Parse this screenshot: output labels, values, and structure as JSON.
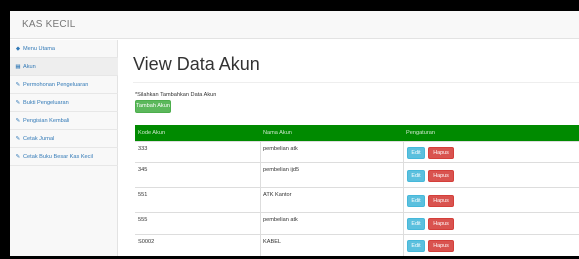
{
  "app": {
    "brand": "KAS KECIL"
  },
  "sidebar": {
    "items": [
      {
        "icon": "dashboard-icon",
        "glyph": "◆",
        "label": "Menu Utama"
      },
      {
        "icon": "table-icon",
        "glyph": "▦",
        "label": "Akun"
      },
      {
        "icon": "edit-icon",
        "glyph": "✎",
        "label": "Permohonan Pengeluaran"
      },
      {
        "icon": "edit-icon",
        "glyph": "✎",
        "label": "Bukti Pengeluaran"
      },
      {
        "icon": "edit-icon",
        "glyph": "✎",
        "label": "Pengisian Kembali"
      },
      {
        "icon": "edit-icon",
        "glyph": "✎",
        "label": "Cetak Jurnal"
      },
      {
        "icon": "edit-icon",
        "glyph": "✎",
        "label": "Cetak Buku Besar Kas Kecil"
      }
    ],
    "active_index": 1
  },
  "main": {
    "title": "View Data Akun",
    "instruction": "*Silahkan Tambahkan Data Akun",
    "add_button": "Tambah Akun"
  },
  "table": {
    "headers": [
      "Kode Akun",
      "Nama Akun",
      "Pengaturan"
    ],
    "rows": [
      {
        "kode": "333",
        "nama": "pembelian atk"
      },
      {
        "kode": "345",
        "nama": "pembelian ijd5"
      },
      {
        "kode": "551",
        "nama": "ATK Kantor"
      },
      {
        "kode": "555",
        "nama": "pembelian atk"
      },
      {
        "kode": "S0002",
        "nama": "KABEL"
      }
    ],
    "edit_label": "Edit",
    "delete_label": "Hapus"
  },
  "colors": {
    "header_green": "#008a00",
    "success": "#5cb85c",
    "info": "#5bc0de",
    "danger": "#d9534f",
    "link": "#337ab7"
  }
}
